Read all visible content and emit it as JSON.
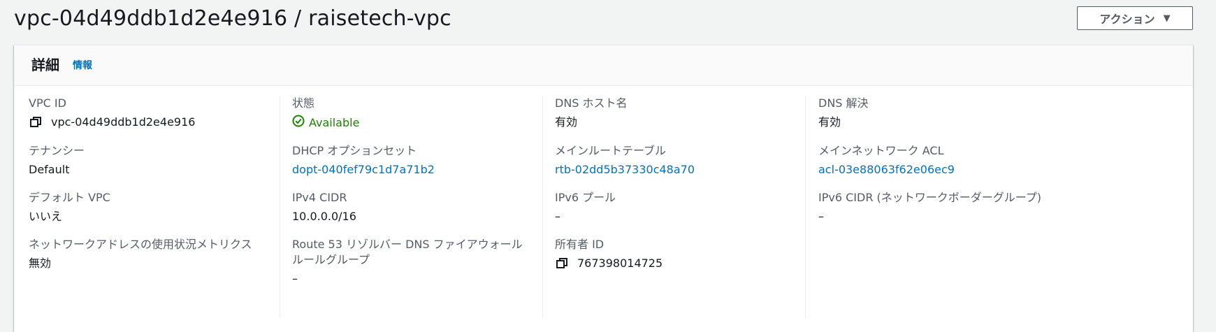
{
  "page": {
    "title": "vpc-04d49ddb1d2e4e916 / raisetech-vpc",
    "actions_label": "アクション"
  },
  "details": {
    "title": "詳細",
    "info_link": "情報",
    "columns": [
      [
        {
          "label": "VPC ID",
          "value": "vpc-04d49ddb1d2e4e916"
        },
        {
          "label": "テナンシー",
          "value": "Default"
        },
        {
          "label": "デフォルト VPC",
          "value": "いいえ"
        },
        {
          "label": "ネットワークアドレスの使用状況メトリクス",
          "value": "無効"
        }
      ],
      [
        {
          "label": "状態",
          "value": "Available"
        },
        {
          "label": "DHCP オプションセット",
          "value": "dopt-040fef79c1d7a71b2"
        },
        {
          "label": "IPv4 CIDR",
          "value": "10.0.0.0/16"
        },
        {
          "label": "Route 53 リゾルバー DNS ファイアウォールルールグループ",
          "value": "–"
        }
      ],
      [
        {
          "label": "DNS ホスト名",
          "value": "有効"
        },
        {
          "label": "メインルートテーブル",
          "value": "rtb-02dd5b37330c48a70"
        },
        {
          "label": "IPv6 プール",
          "value": "–"
        },
        {
          "label": "所有者 ID",
          "value": "767398014725"
        }
      ],
      [
        {
          "label": "DNS 解決",
          "value": "有効"
        },
        {
          "label": "メインネットワーク ACL",
          "value": "acl-03e88063f62e06ec9"
        },
        {
          "label": "IPv6 CIDR (ネットワークボーダーグループ)",
          "value": "–"
        }
      ]
    ]
  },
  "colors": {
    "link": "#0073bb",
    "success": "#1d8102",
    "label": "#545b64",
    "text": "#16191f"
  }
}
